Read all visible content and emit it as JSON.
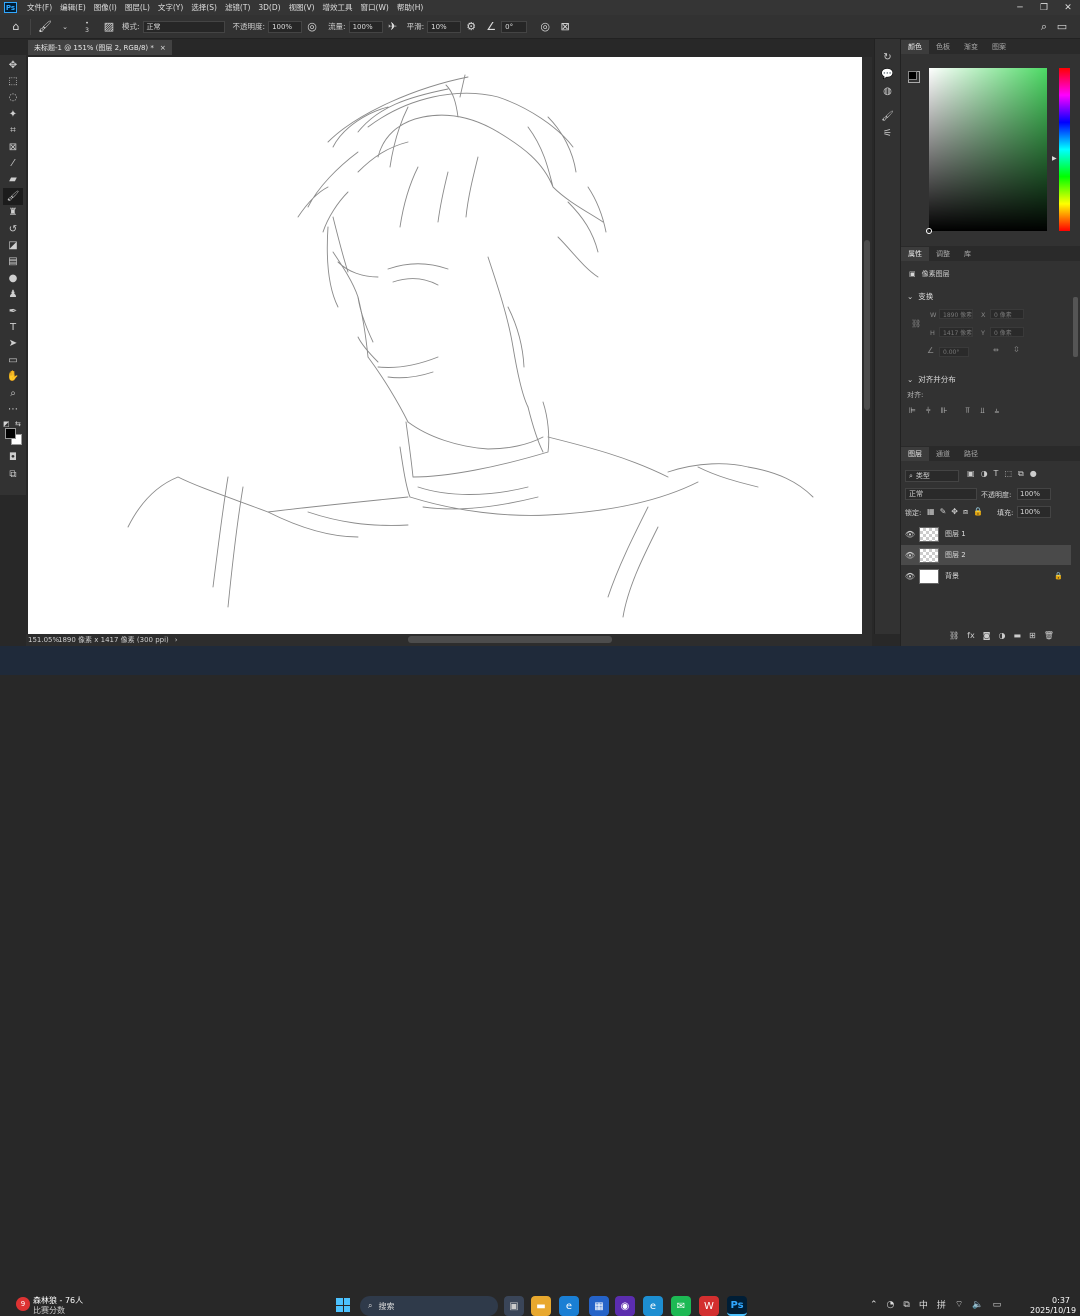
{
  "app": {
    "logo": "Ps",
    "menus": [
      "文件(F)",
      "编辑(E)",
      "图像(I)",
      "图层(L)",
      "文字(Y)",
      "选择(S)",
      "滤镜(T)",
      "3D(D)",
      "视图(V)",
      "增效工具",
      "窗口(W)",
      "帮助(H)"
    ]
  },
  "options": {
    "brush_size": "3",
    "mode_label": "模式:",
    "mode_value": "正常",
    "opacity_label": "不透明度:",
    "opacity_value": "100%",
    "flow_label": "流量:",
    "flow_value": "100%",
    "smooth_label": "平滑:",
    "smooth_value": "10%",
    "angle_value": "0°"
  },
  "document": {
    "tab_title": "未标题-1 @ 151% (图层 2, RGB/8) *",
    "zoom": "151.05%",
    "dimensions": "1890 像素 x 1417 像素 (300 ppi)"
  },
  "panels": {
    "color_tabs": [
      "颜色",
      "色板",
      "渐变",
      "图案"
    ],
    "props_tabs": [
      "属性",
      "调整",
      "库"
    ],
    "pixel_layer": "像素图层",
    "transform_title": "变换",
    "transform": {
      "w_label": "W",
      "w_value": "1890 像素",
      "h_label": "H",
      "h_value": "1417 像素",
      "x_label": "X",
      "x_value": "0 像素",
      "y_label": "Y",
      "y_value": "0 像素",
      "angle_value": "0.00°"
    },
    "align_title": "对齐并分布",
    "align_label": "对齐:",
    "layers_tabs": [
      "图层",
      "通道",
      "路径"
    ],
    "filter_kind": "类型",
    "blend_mode": "正常",
    "layer_opacity_label": "不透明度:",
    "layer_opacity": "100%",
    "lock_label": "锁定:",
    "fill_label": "填充:",
    "fill_value": "100%",
    "layers": [
      {
        "name": "图层 1",
        "selected": false,
        "transparent": true
      },
      {
        "name": "图层 2",
        "selected": true,
        "transparent": true
      },
      {
        "name": "背景",
        "selected": false,
        "transparent": false
      }
    ]
  },
  "taskbar": {
    "notif_badge": "9",
    "notif_title": "森林狼 - 76人",
    "notif_subtitle": "比赛分数",
    "search_label": "搜索",
    "tray": {
      "ime1": "中",
      "ime2": "拼",
      "time": "0:37",
      "date": "2025/10/19"
    }
  },
  "colors": {
    "foreground": "#000000",
    "background": "#ffffff",
    "accent": "#31a8ff"
  }
}
